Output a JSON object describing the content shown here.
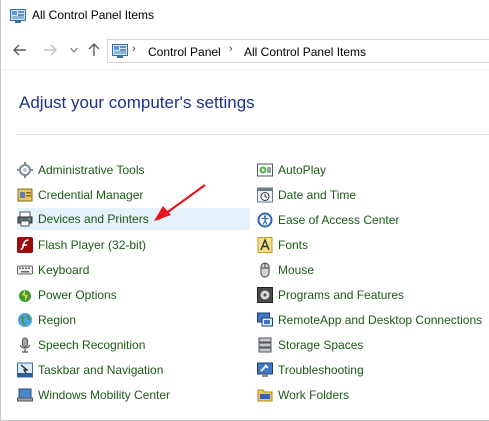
{
  "window": {
    "title": "All Control Panel Items"
  },
  "navigation": {
    "back_icon": "arrow-left-icon",
    "forward_icon": "arrow-right-icon",
    "recent_icon": "chevron-down-icon",
    "up_icon": "arrow-up-icon"
  },
  "address": {
    "crumbs": [
      "Control Panel",
      "All Control Panel Items"
    ]
  },
  "main": {
    "heading": "Adjust your computer's settings",
    "left_items": [
      {
        "label": "Administrative Tools",
        "icon": "tools-icon"
      },
      {
        "label": "Credential Manager",
        "icon": "credential-icon"
      },
      {
        "label": "Devices and Printers",
        "icon": "printer-icon"
      },
      {
        "label": "Flash Player (32-bit)",
        "icon": "flash-icon"
      },
      {
        "label": "Keyboard",
        "icon": "keyboard-icon"
      },
      {
        "label": "Power Options",
        "icon": "power-icon"
      },
      {
        "label": "Region",
        "icon": "globe-icon"
      },
      {
        "label": "Speech Recognition",
        "icon": "microphone-icon"
      },
      {
        "label": "Taskbar and Navigation",
        "icon": "taskbar-icon"
      },
      {
        "label": "Windows Mobility Center",
        "icon": "mobility-icon"
      }
    ],
    "right_items": [
      {
        "label": "AutoPlay",
        "icon": "autoplay-icon"
      },
      {
        "label": "Date and Time",
        "icon": "clock-icon"
      },
      {
        "label": "Ease of Access Center",
        "icon": "accessibility-icon"
      },
      {
        "label": "Fonts",
        "icon": "fonts-icon"
      },
      {
        "label": "Mouse",
        "icon": "mouse-icon"
      },
      {
        "label": "Programs and Features",
        "icon": "programs-icon"
      },
      {
        "label": "RemoteApp and Desktop Connections",
        "icon": "remote-desktop-icon"
      },
      {
        "label": "Storage Spaces",
        "icon": "storage-icon"
      },
      {
        "label": "Troubleshooting",
        "icon": "troubleshoot-icon"
      },
      {
        "label": "Work Folders",
        "icon": "folder-icon"
      }
    ]
  },
  "colors": {
    "link": "#1c5a16",
    "heading": "#1e3287",
    "highlight": "#e5f1fb",
    "annotation_arrow": "#e8141b"
  },
  "annotation": {
    "icon": "red-arrow-icon"
  }
}
